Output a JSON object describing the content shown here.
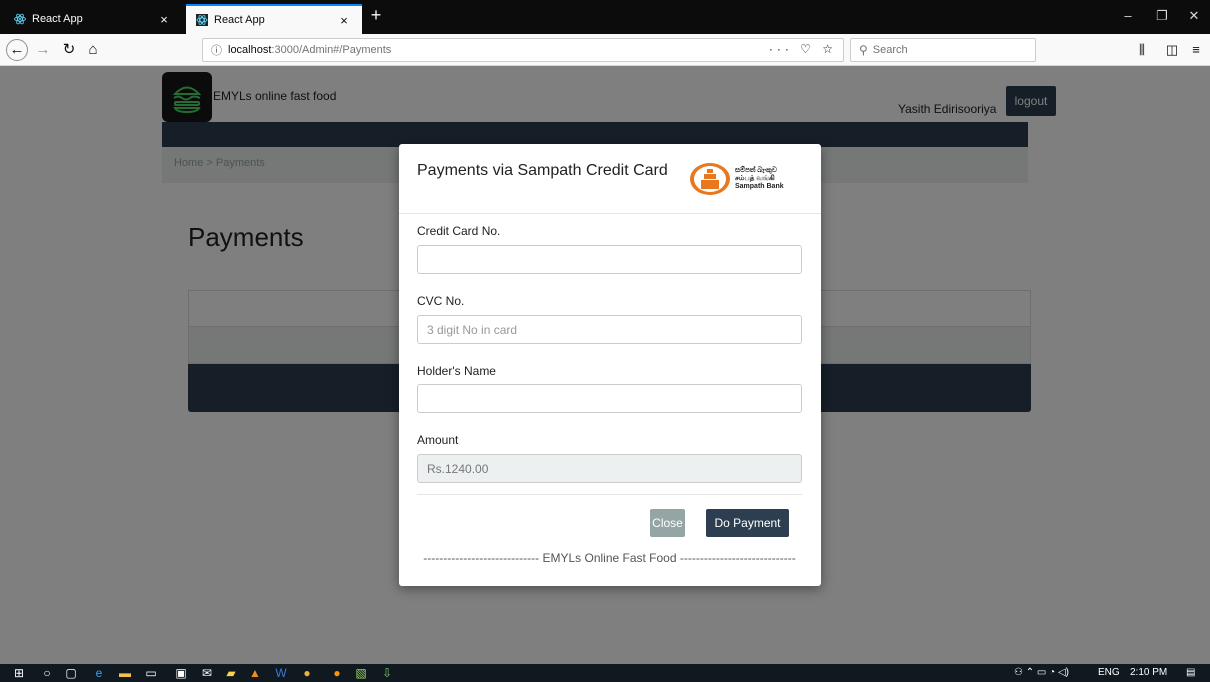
{
  "browser": {
    "tabs": [
      {
        "title": "React App",
        "active": false
      },
      {
        "title": "React App",
        "active": true
      }
    ],
    "url_host": "localhost",
    "url_rest": ":3000/Admin#/Payments",
    "search_placeholder": "Search",
    "accent": "#0a84ff"
  },
  "header": {
    "brand": "EMYLs online fast food",
    "username": "Yasith Edirisooriya",
    "logout_label": "logout",
    "nav_color": "#2c3e50"
  },
  "breadcrumb": "Home > Payments",
  "page_title": "Payments",
  "modal": {
    "title": "Payments via Sampath Credit Card",
    "bank": {
      "line1": "සම්පත් බැංකුව",
      "line2": "சம்பத் வங்கி",
      "line3": "Sampath Bank",
      "color": "#e8771e"
    },
    "fields": [
      {
        "label": "Credit Card No.",
        "value": "",
        "placeholder": ""
      },
      {
        "label": "CVC No.",
        "value": "",
        "placeholder": "3 digit No in card"
      },
      {
        "label": "Holder's Name",
        "value": "",
        "placeholder": ""
      },
      {
        "label": "Amount",
        "value": "Rs.1240.00",
        "placeholder": ""
      }
    ],
    "close_label": "Close",
    "pay_label": "Do Payment",
    "footer_text": "----------------------------- EMYLs Online Fast Food -----------------------------"
  },
  "taskbar": {
    "tray_lang": "ENG",
    "time": "2:10 PM"
  }
}
